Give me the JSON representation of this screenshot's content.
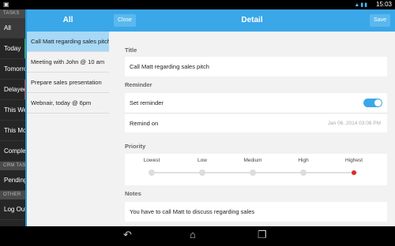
{
  "status_bar": {
    "time": "15:03",
    "notification_icon": "image-icon",
    "status_icons": "wifi signal battery"
  },
  "sidebar": {
    "sections": [
      {
        "header": "TASKS",
        "items": [
          {
            "label": "All",
            "selected": true,
            "accent": ""
          },
          {
            "label": "Today",
            "accent": "#4caf50"
          },
          {
            "label": "Tomorrow",
            "accent": ""
          },
          {
            "label": "Delayed",
            "accent": "#e53935"
          },
          {
            "label": "This Week",
            "accent": ""
          },
          {
            "label": "This Month",
            "accent": ""
          },
          {
            "label": "Completed",
            "accent": ""
          }
        ]
      },
      {
        "header": "CRM TASKS",
        "items": [
          {
            "label": "Pending",
            "accent": ""
          }
        ]
      },
      {
        "header": "OTHER",
        "items": [
          {
            "label": "Log Out",
            "accent": ""
          }
        ]
      }
    ]
  },
  "task_list": {
    "title": "All",
    "items": [
      {
        "label": "Call Matt regarding sales pitch",
        "selected": true
      },
      {
        "label": "Meeting with John @ 10 am"
      },
      {
        "label": "Prepare sales presentation"
      },
      {
        "label": "Webnair, today @ 6pm"
      }
    ]
  },
  "detail": {
    "title": "Detail",
    "close_label": "Close",
    "save_label": "Save",
    "title_section": "Title",
    "title_value": "Call Matt regarding sales pitch",
    "reminder_section": "Reminder",
    "set_reminder_label": "Set reminder",
    "set_reminder_on": true,
    "remind_on_label": "Remind on",
    "remind_on_value": "Jan 06, 2014 03:08 PM",
    "priority_section": "Priority",
    "priority_levels": [
      "Lowest",
      "Low",
      "Medium",
      "High",
      "Highest"
    ],
    "priority_selected": "Highest",
    "notes_section": "Notes",
    "notes_value": "You have to call Matt to discuss regarding sales"
  },
  "nav_bar": {
    "icons": [
      "back-icon",
      "home-icon",
      "recent-apps-icon"
    ]
  },
  "colors": {
    "accent": "#3aa7e8",
    "selection": "#a7d8f6",
    "priority_selected": "#e02a2a"
  }
}
